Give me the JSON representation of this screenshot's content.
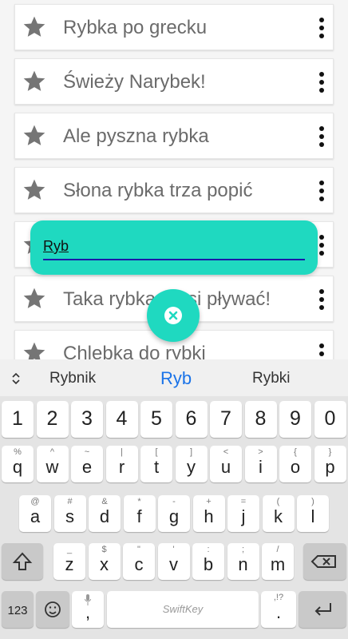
{
  "list": {
    "items": [
      {
        "title": "Rybka po grecku"
      },
      {
        "title": "Świeży Narybek!"
      },
      {
        "title": "Ale pyszna rybka"
      },
      {
        "title": "Słona rybka trza popić"
      },
      {
        "title": ""
      },
      {
        "title": "Taka rybka musi pływać!"
      },
      {
        "title": "Chlebka do rybki"
      }
    ]
  },
  "popup": {
    "input_value": "Ryb"
  },
  "keyboard": {
    "suggestions": [
      "Rybnik",
      "Ryb",
      "Rybki"
    ],
    "number_row": [
      "1",
      "2",
      "3",
      "4",
      "5",
      "6",
      "7",
      "8",
      "9",
      "0"
    ],
    "row1": [
      {
        "main": "q",
        "alt": "%"
      },
      {
        "main": "w",
        "alt": "^"
      },
      {
        "main": "e",
        "alt": "~"
      },
      {
        "main": "r",
        "alt": "|"
      },
      {
        "main": "t",
        "alt": "["
      },
      {
        "main": "y",
        "alt": "]"
      },
      {
        "main": "u",
        "alt": "<"
      },
      {
        "main": "i",
        "alt": ">"
      },
      {
        "main": "o",
        "alt": "{"
      },
      {
        "main": "p",
        "alt": "}"
      }
    ],
    "row2": [
      {
        "main": "a",
        "alt": "@"
      },
      {
        "main": "s",
        "alt": "#"
      },
      {
        "main": "d",
        "alt": "&"
      },
      {
        "main": "f",
        "alt": "*"
      },
      {
        "main": "g",
        "alt": "-"
      },
      {
        "main": "h",
        "alt": "+"
      },
      {
        "main": "j",
        "alt": "="
      },
      {
        "main": "k",
        "alt": "("
      },
      {
        "main": "l",
        "alt": ")"
      }
    ],
    "row3": [
      {
        "main": "z",
        "alt": "_"
      },
      {
        "main": "x",
        "alt": "$"
      },
      {
        "main": "c",
        "alt": "\""
      },
      {
        "main": "v",
        "alt": "'"
      },
      {
        "main": "b",
        "alt": ":"
      },
      {
        "main": "n",
        "alt": ";"
      },
      {
        "main": "m",
        "alt": "/"
      }
    ],
    "bottom": {
      "symbols_label": "123",
      "comma": ",",
      "space_brand": "SwiftKey",
      "period": ".",
      "period_alt": ",!?"
    }
  },
  "colors": {
    "accent": "#1fd9c0",
    "suggestion_active": "#1a73e8",
    "input_underline": "#1a1aa8"
  }
}
